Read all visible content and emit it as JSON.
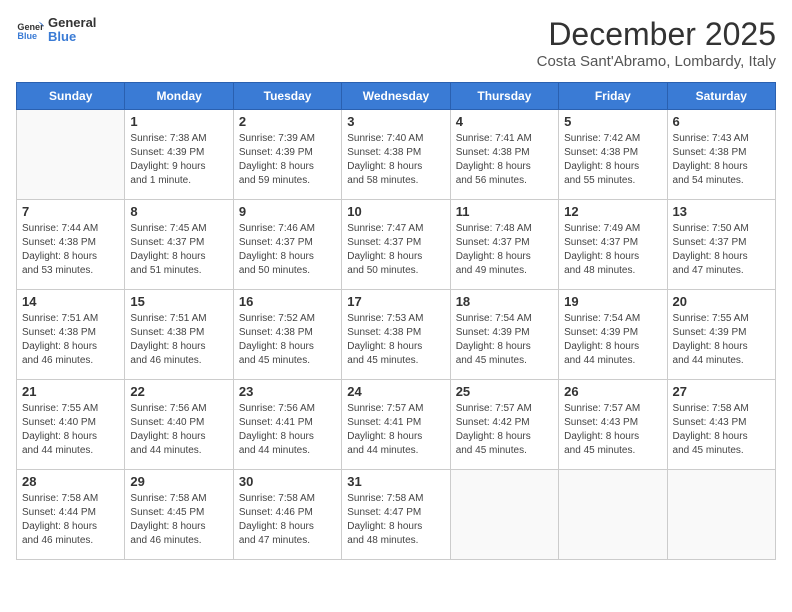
{
  "logo": {
    "line1": "General",
    "line2": "Blue"
  },
  "title": "December 2025",
  "subtitle": "Costa Sant'Abramo, Lombardy, Italy",
  "days_of_week": [
    "Sunday",
    "Monday",
    "Tuesday",
    "Wednesday",
    "Thursday",
    "Friday",
    "Saturday"
  ],
  "weeks": [
    [
      {
        "day": "",
        "info": ""
      },
      {
        "day": "1",
        "info": "Sunrise: 7:38 AM\nSunset: 4:39 PM\nDaylight: 9 hours\nand 1 minute."
      },
      {
        "day": "2",
        "info": "Sunrise: 7:39 AM\nSunset: 4:39 PM\nDaylight: 8 hours\nand 59 minutes."
      },
      {
        "day": "3",
        "info": "Sunrise: 7:40 AM\nSunset: 4:38 PM\nDaylight: 8 hours\nand 58 minutes."
      },
      {
        "day": "4",
        "info": "Sunrise: 7:41 AM\nSunset: 4:38 PM\nDaylight: 8 hours\nand 56 minutes."
      },
      {
        "day": "5",
        "info": "Sunrise: 7:42 AM\nSunset: 4:38 PM\nDaylight: 8 hours\nand 55 minutes."
      },
      {
        "day": "6",
        "info": "Sunrise: 7:43 AM\nSunset: 4:38 PM\nDaylight: 8 hours\nand 54 minutes."
      }
    ],
    [
      {
        "day": "7",
        "info": "Sunrise: 7:44 AM\nSunset: 4:38 PM\nDaylight: 8 hours\nand 53 minutes."
      },
      {
        "day": "8",
        "info": "Sunrise: 7:45 AM\nSunset: 4:37 PM\nDaylight: 8 hours\nand 51 minutes."
      },
      {
        "day": "9",
        "info": "Sunrise: 7:46 AM\nSunset: 4:37 PM\nDaylight: 8 hours\nand 50 minutes."
      },
      {
        "day": "10",
        "info": "Sunrise: 7:47 AM\nSunset: 4:37 PM\nDaylight: 8 hours\nand 50 minutes."
      },
      {
        "day": "11",
        "info": "Sunrise: 7:48 AM\nSunset: 4:37 PM\nDaylight: 8 hours\nand 49 minutes."
      },
      {
        "day": "12",
        "info": "Sunrise: 7:49 AM\nSunset: 4:37 PM\nDaylight: 8 hours\nand 48 minutes."
      },
      {
        "day": "13",
        "info": "Sunrise: 7:50 AM\nSunset: 4:37 PM\nDaylight: 8 hours\nand 47 minutes."
      }
    ],
    [
      {
        "day": "14",
        "info": "Sunrise: 7:51 AM\nSunset: 4:38 PM\nDaylight: 8 hours\nand 46 minutes."
      },
      {
        "day": "15",
        "info": "Sunrise: 7:51 AM\nSunset: 4:38 PM\nDaylight: 8 hours\nand 46 minutes."
      },
      {
        "day": "16",
        "info": "Sunrise: 7:52 AM\nSunset: 4:38 PM\nDaylight: 8 hours\nand 45 minutes."
      },
      {
        "day": "17",
        "info": "Sunrise: 7:53 AM\nSunset: 4:38 PM\nDaylight: 8 hours\nand 45 minutes."
      },
      {
        "day": "18",
        "info": "Sunrise: 7:54 AM\nSunset: 4:39 PM\nDaylight: 8 hours\nand 45 minutes."
      },
      {
        "day": "19",
        "info": "Sunrise: 7:54 AM\nSunset: 4:39 PM\nDaylight: 8 hours\nand 44 minutes."
      },
      {
        "day": "20",
        "info": "Sunrise: 7:55 AM\nSunset: 4:39 PM\nDaylight: 8 hours\nand 44 minutes."
      }
    ],
    [
      {
        "day": "21",
        "info": "Sunrise: 7:55 AM\nSunset: 4:40 PM\nDaylight: 8 hours\nand 44 minutes."
      },
      {
        "day": "22",
        "info": "Sunrise: 7:56 AM\nSunset: 4:40 PM\nDaylight: 8 hours\nand 44 minutes."
      },
      {
        "day": "23",
        "info": "Sunrise: 7:56 AM\nSunset: 4:41 PM\nDaylight: 8 hours\nand 44 minutes."
      },
      {
        "day": "24",
        "info": "Sunrise: 7:57 AM\nSunset: 4:41 PM\nDaylight: 8 hours\nand 44 minutes."
      },
      {
        "day": "25",
        "info": "Sunrise: 7:57 AM\nSunset: 4:42 PM\nDaylight: 8 hours\nand 45 minutes."
      },
      {
        "day": "26",
        "info": "Sunrise: 7:57 AM\nSunset: 4:43 PM\nDaylight: 8 hours\nand 45 minutes."
      },
      {
        "day": "27",
        "info": "Sunrise: 7:58 AM\nSunset: 4:43 PM\nDaylight: 8 hours\nand 45 minutes."
      }
    ],
    [
      {
        "day": "28",
        "info": "Sunrise: 7:58 AM\nSunset: 4:44 PM\nDaylight: 8 hours\nand 46 minutes."
      },
      {
        "day": "29",
        "info": "Sunrise: 7:58 AM\nSunset: 4:45 PM\nDaylight: 8 hours\nand 46 minutes."
      },
      {
        "day": "30",
        "info": "Sunrise: 7:58 AM\nSunset: 4:46 PM\nDaylight: 8 hours\nand 47 minutes."
      },
      {
        "day": "31",
        "info": "Sunrise: 7:58 AM\nSunset: 4:47 PM\nDaylight: 8 hours\nand 48 minutes."
      },
      {
        "day": "",
        "info": ""
      },
      {
        "day": "",
        "info": ""
      },
      {
        "day": "",
        "info": ""
      }
    ]
  ]
}
